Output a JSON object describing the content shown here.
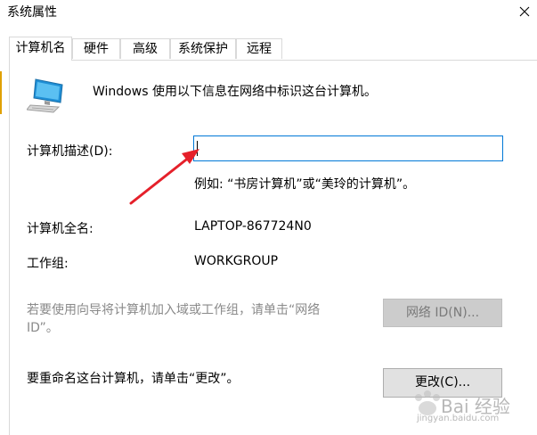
{
  "window": {
    "title": "系统属性"
  },
  "tabs": [
    {
      "label": "计算机名",
      "active": true
    },
    {
      "label": "硬件",
      "active": false
    },
    {
      "label": "高级",
      "active": false
    },
    {
      "label": "系统保护",
      "active": false
    },
    {
      "label": "远程",
      "active": false
    }
  ],
  "intro_text": "Windows 使用以下信息在网络中标识这台计算机。",
  "description": {
    "label": "计算机描述(D):",
    "value": "",
    "example": "例如: “书房计算机”或“美玲的计算机”。"
  },
  "full_name": {
    "label": "计算机全名:",
    "value": "LAPTOP-867724N0"
  },
  "workgroup": {
    "label": "工作组:",
    "value": "WORKGROUP"
  },
  "network_id": {
    "text_line1": "若要使用向导将计算机加入域或工作组，请单击“网络",
    "text_line2": "ID”。",
    "button_label": "网络 ID(N)..."
  },
  "rename": {
    "text": "要重命名这台计算机，请单击“更改”。",
    "button_label": "更改(C)..."
  },
  "watermark": {
    "brand": "Bai 经验",
    "url": "jingyan.baidu.com"
  },
  "colors": {
    "annotation_arrow": "#e5202a",
    "input_focus_border": "#0078d7",
    "disabled_text": "#8a8a8a"
  },
  "icons": {
    "close": "close-icon",
    "computer": "computer-icon",
    "annotation": "red-arrow-annotation"
  }
}
